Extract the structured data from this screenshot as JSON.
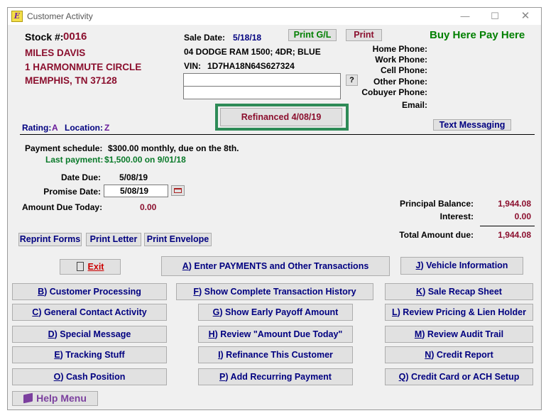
{
  "window": {
    "title": "Customer Activity",
    "icon": "app-logo-icon"
  },
  "stock": {
    "label": "Stock #:",
    "number": "0016"
  },
  "customer": {
    "name": "MILES DAVIS",
    "address1": "1 HARMONMUTE CIRCLE",
    "city_state_zip": "MEMPHIS,  TN 37128"
  },
  "sale": {
    "label": "Sale Date:",
    "date": "5/18/18"
  },
  "vehicle": {
    "description": "04 DODGE RAM 1500; 4DR; BLUE",
    "vin_label": "VIN:",
    "vin": "1D7HA18N64S627324"
  },
  "header_buttons": {
    "print_gl": "Print G/L",
    "print": "Print",
    "question": "?"
  },
  "brand": "Buy Here Pay Here",
  "phones": {
    "home": "Home Phone:",
    "work": "Work Phone:",
    "cell": "Cell Phone:",
    "other": "Other Phone:",
    "cobuyer": "Cobuyer Phone:",
    "email": "Email:"
  },
  "refinanced": "Refinanced  4/08/19",
  "rating": {
    "label": "Rating:",
    "value": "A",
    "location_label": "Location:",
    "location_value": "Z"
  },
  "text_messaging": "Text Messaging",
  "schedule": {
    "label": "Payment schedule:",
    "value": "$300.00 monthly, due on the 8th.",
    "last_label": "Last payment:",
    "last_value": "$1,500.00 on  9/01/18"
  },
  "due": {
    "date_due_label": "Date Due:",
    "date_due": "5/08/19",
    "promise_label": "Promise Date:",
    "promise_value": "5/08/19",
    "amount_today_label": "Amount Due Today:",
    "amount_today": "0.00"
  },
  "balance": {
    "principal_label": "Principal Balance:",
    "principal": "1,944.08",
    "interest_label": "Interest:",
    "interest": "0.00",
    "total_label": "Total Amount due:",
    "total": "1,944.08"
  },
  "print_buttons": {
    "reprint": "Reprint Forms",
    "letter": "Print Letter",
    "envelope": "Print Envelope"
  },
  "exit": "Exit",
  "actions": {
    "a_key": "A",
    "a": ") Enter PAYMENTS and Other Transactions",
    "j_key": "J",
    "j": ") Vehicle Information",
    "b_key": "B",
    "b": ") Customer Processing",
    "f_key": "F",
    "f": ") Show Complete Transaction History",
    "k_key": "K",
    "k": ") Sale Recap Sheet",
    "c_key": "C",
    "c": ") General Contact Activity",
    "g_key": "G",
    "g": ") Show Early Payoff Amount",
    "l_key": "L",
    "l": ") Review Pricing & Lien Holder",
    "d_key": "D",
    "d": ") Special Message",
    "h_key": "H",
    "h": ") Review \"Amount Due Today\"",
    "m_key": "M",
    "m": ") Review Audit Trail",
    "e_key": "E",
    "e": ") Tracking Stuff",
    "i_key": "I",
    "i": ") Refinance This Customer",
    "n_key": "N",
    "n": ") Credit Report",
    "o_key": "O",
    "o": ") Cash Position",
    "p_key": "P",
    "p": ") Add Recurring Payment",
    "q_key": "Q",
    "q": ") Credit Card or ACH Setup"
  },
  "help_menu": "Help Menu"
}
